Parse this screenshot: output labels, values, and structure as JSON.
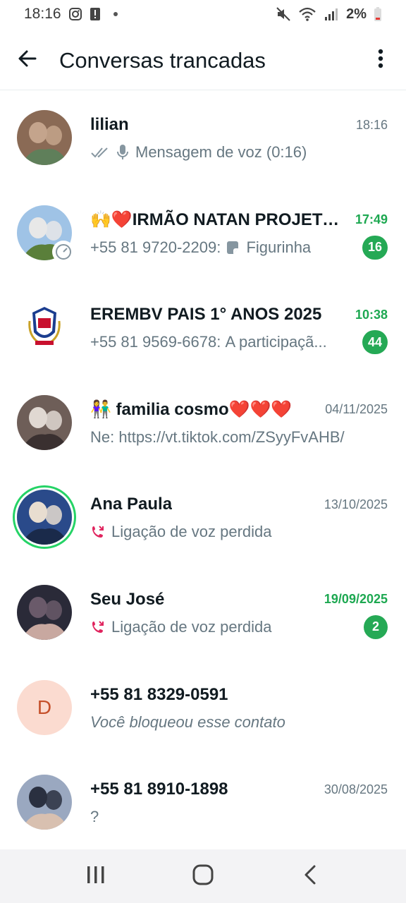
{
  "status_bar": {
    "time": "18:16",
    "battery": "2%"
  },
  "header": {
    "title": "Conversas trancadas"
  },
  "chats": [
    {
      "name": "lilian",
      "time": "18:16",
      "time_unread": false,
      "preview": "Mensagem de voz (0:16)",
      "preview_prefix": "",
      "preview_icon": "mic-icon",
      "check_icon": "double-check-icon",
      "unread": "",
      "avatar_type": "photo",
      "avatar_colors": [
        "#8a6a55",
        "#c4a48c",
        "#5f7f5a"
      ]
    },
    {
      "name": "🙌❤️IRMÃO NATAN PROJETO...",
      "time": "17:49",
      "time_unread": true,
      "preview": "Figurinha",
      "preview_prefix": "+55 81 9720-2209: ",
      "preview_icon": "sticker-icon",
      "unread": "16",
      "avatar_type": "photo",
      "avatar_colors": [
        "#9fc3e6",
        "#e8e8e8",
        "#5a7f3a"
      ],
      "badge_icon": "timer-icon"
    },
    {
      "name": "EREMBV PAIS 1° ANOS 2025",
      "time": "10:38",
      "time_unread": true,
      "preview": "A participaçã...",
      "preview_prefix": "+55 81 9569-6678: ",
      "unread": "44",
      "avatar_type": "crest",
      "avatar_colors": [
        "#1b3d8f",
        "#c8102e",
        "#c9a227"
      ]
    },
    {
      "name": "👫 familia cosmo❤️❤️❤️",
      "time": "04/11/2025",
      "time_unread": false,
      "preview": "https://vt.tiktok.com/ZSyyFvAHB/",
      "preview_prefix": "Ne: ",
      "unread": "",
      "avatar_type": "photo",
      "avatar_colors": [
        "#6e5e58",
        "#e0d8d2",
        "#3a3030"
      ]
    },
    {
      "name": "Ana Paula",
      "time": "13/10/2025",
      "time_unread": false,
      "preview": "Ligação de voz perdida",
      "preview_prefix": "",
      "preview_icon": "missed-call-icon",
      "unread": "",
      "avatar_type": "photo",
      "status_ring": true,
      "avatar_colors": [
        "#2a4a8a",
        "#e8ddd0",
        "#1a2a4a"
      ]
    },
    {
      "name": "Seu José",
      "time": "19/09/2025",
      "time_unread": true,
      "preview": "Ligação de voz perdida",
      "preview_prefix": "",
      "preview_icon": "missed-call-icon",
      "unread": "2",
      "avatar_type": "photo",
      "avatar_colors": [
        "#2a2a38",
        "#6a5a6a",
        "#c8a8a0"
      ]
    },
    {
      "name": "+55 81 8329-0591",
      "time": "",
      "time_unread": false,
      "preview": "Você bloqueou esse contato",
      "preview_prefix": "",
      "preview_italic": true,
      "unread": "",
      "avatar_type": "letter",
      "avatar_letter": "D"
    },
    {
      "name": "+55 81 8910-1898",
      "time": "30/08/2025",
      "time_unread": false,
      "preview": "?",
      "preview_prefix": "",
      "unread": "",
      "avatar_type": "photo",
      "avatar_colors": [
        "#9aa8c0",
        "#2a3040",
        "#d8c0b0"
      ]
    }
  ],
  "colors": {
    "accent": "#25d366",
    "unread_badge": "#25a955",
    "missed_call": "#e0245e"
  }
}
